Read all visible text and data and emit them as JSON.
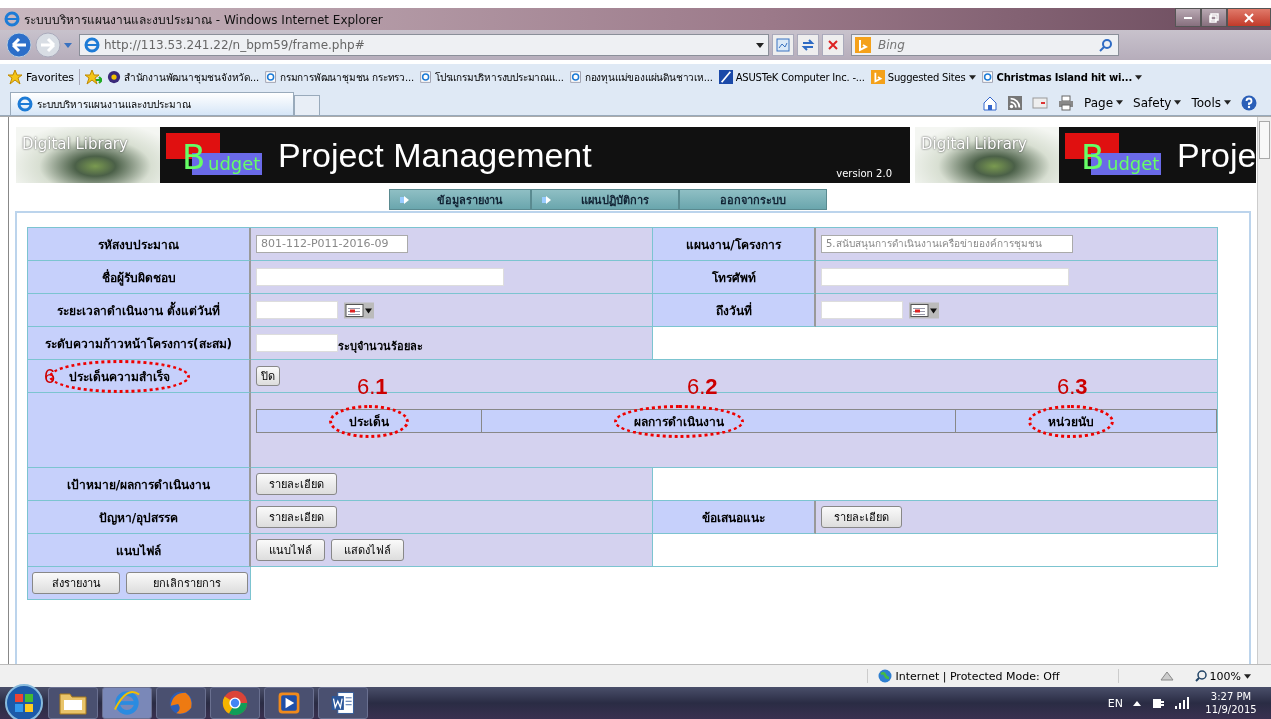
{
  "window": {
    "title": "ระบบบริหารแผนงานและงบประมาณ - Windows Internet Explorer"
  },
  "address_bar": {
    "url": "http://113.53.241.22/n_bpm59/frame.php#"
  },
  "search": {
    "placeholder": "Bing"
  },
  "favorites": {
    "label": "Favorites",
    "items": [
      {
        "label": "สำนักงานพัฒนาชุมชนจังหวัด...",
        "kind": "emblem"
      },
      {
        "label": "กรมการพัฒนาชุมชน กระทรว...",
        "kind": "page"
      },
      {
        "label": "โปรแกรมบริหารงบประมาณแ...",
        "kind": "page"
      },
      {
        "label": "กองทุนแม่ของแผ่นดินชาวเห...",
        "kind": "page"
      },
      {
        "label": "ASUSTeK Computer Inc. -...",
        "kind": "asus"
      },
      {
        "label": "Suggested Sites",
        "kind": "bing"
      },
      {
        "label": "Christmas Island hit wi...",
        "kind": "page"
      }
    ]
  },
  "tab": {
    "title": "ระบบบริหารแผนงานและงบประมาณ"
  },
  "command_bar": [
    "Page",
    "Safety",
    "Tools"
  ],
  "banners": [
    {
      "library": "Digital Library",
      "letter": "B",
      "rest": "udget",
      "title": "Project Management",
      "version": "version 2.0"
    },
    {
      "library": "Digital Library",
      "letter": "B",
      "rest": "udget",
      "title": "Proje"
    }
  ],
  "nav": [
    {
      "label": "ข้อมูลรายงาน",
      "arrow": true
    },
    {
      "label": "แผนปฏิบัติการ",
      "arrow": true
    },
    {
      "label": "ออกจากระบบ",
      "arrow": false
    }
  ],
  "form": {
    "budget_code": {
      "label": "รหัสงบประมาณ",
      "value": "801-112-P011-2016-09",
      "disabled": true
    },
    "plan": {
      "label": "แผนงาน/โครงการ",
      "value": "5.สนับสนุนการดำเนินงานเครือข่ายองค์การชุมชน",
      "disabled": true
    },
    "responsible": {
      "label": "ชื่อผู้รับผิดชอบ"
    },
    "phone": {
      "label": "โทรศัพท์"
    },
    "start_date": {
      "label": "ระยะเวลาดำเนินงาน ตั้งแต่วันที่"
    },
    "end_date": {
      "label": "ถึงวันที่"
    },
    "progress": {
      "label": "ระดับความก้าวหน้าโครงการ(สะสม)",
      "hint": "ระบุจำนวนร้อยละ"
    },
    "success": {
      "label": "ประเด็นความสำเร็จ",
      "annotation": "6",
      "button": "ปิด"
    },
    "success_table": {
      "columns": [
        {
          "label": "ประเด็น",
          "annotation": "6.**1**"
        },
        {
          "label": "ผลการดำเนินงาน",
          "annotation": "6.**2**"
        },
        {
          "label": "หน่วยนับ",
          "annotation": "6.**3**"
        }
      ]
    },
    "target": {
      "label": "เป้าหมาย/ผลการดำเนินงาน",
      "button": "รายละเอียด"
    },
    "problems": {
      "label": "ปัญหา/อุปสรรค",
      "button": "รายละเอียด"
    },
    "suggestions": {
      "label": "ข้อเสนอแนะ",
      "button": "รายละเอียด"
    },
    "attachments": {
      "label": "แนบไฟล์",
      "buttons": [
        "แนบไฟล์",
        "แสดงไฟล์"
      ]
    },
    "actions": [
      "ส่งรายงาน",
      "ยกเลิกรายการ"
    ]
  },
  "status_bar": {
    "zone": "Internet | Protected Mode: Off",
    "zoom": "100%"
  },
  "taskbar": {
    "language": "EN",
    "time": "3:27 PM",
    "date": "11/9/2015"
  }
}
